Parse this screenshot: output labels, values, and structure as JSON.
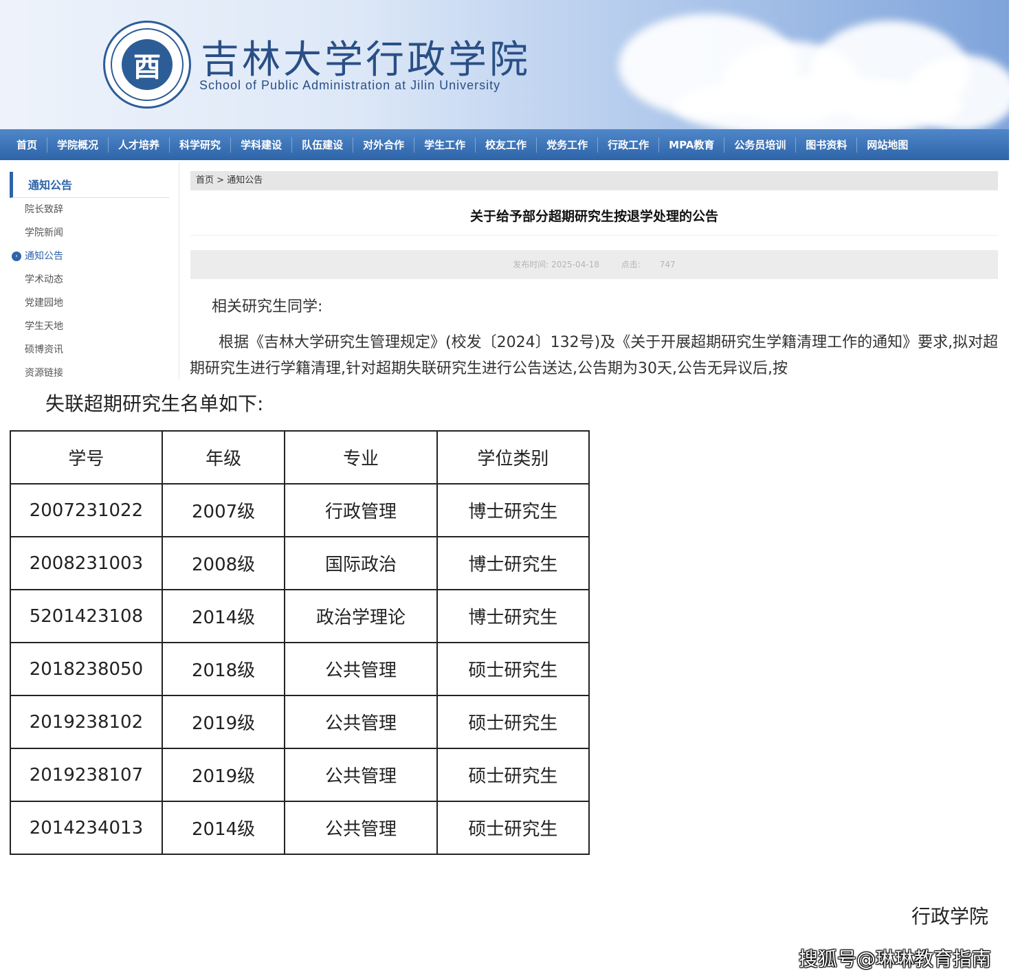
{
  "header": {
    "logo_glyph": "酉",
    "title_cn": "吉林大学行政学院",
    "title_en": "School of Public Administration at Jilin University"
  },
  "nav": {
    "items": [
      "首页",
      "学院概况",
      "人才培养",
      "科学研究",
      "学科建设",
      "队伍建设",
      "对外合作",
      "学生工作",
      "校友工作",
      "党务工作",
      "行政工作",
      "MPA教育",
      "公务员培训",
      "图书资料",
      "网站地图"
    ]
  },
  "sidebar": {
    "heading": "通知公告",
    "items": [
      {
        "label": "院长致辞",
        "active": false
      },
      {
        "label": "学院新闻",
        "active": false
      },
      {
        "label": "通知公告",
        "active": true
      },
      {
        "label": "学术动态",
        "active": false
      },
      {
        "label": "党建园地",
        "active": false
      },
      {
        "label": "学生天地",
        "active": false
      },
      {
        "label": "硕博资讯",
        "active": false
      },
      {
        "label": "资源链接",
        "active": false
      }
    ]
  },
  "breadcrumb": {
    "home": "首页",
    "separator": ">",
    "current": "通知公告"
  },
  "article": {
    "title": "关于给予部分超期研究生按退学处理的公告",
    "publish_label": "发布时间: 2025-04-18",
    "views_label": "点击:",
    "views_value": "747",
    "greeting": "相关研究生同学:",
    "paragraph": "根据《吉林大学研究生管理规定》(校发〔2024〕132号)及《关于开展超期研究生学籍清理工作的通知》要求,拟对超期研究生进行学籍清理,针对超期失联研究生进行公告送达,公告期为30天,公告无异议后,按"
  },
  "document": {
    "list_heading": "失联超期研究生名单如下:",
    "table": {
      "headers": [
        "学号",
        "年级",
        "专业",
        "学位类别"
      ],
      "rows": [
        [
          "2007231022",
          "2007级",
          "行政管理",
          "博士研究生"
        ],
        [
          "2008231003",
          "2008级",
          "国际政治",
          "博士研究生"
        ],
        [
          "5201423108",
          "2014级",
          "政治学理论",
          "博士研究生"
        ],
        [
          "2018238050",
          "2018级",
          "公共管理",
          "硕士研究生"
        ],
        [
          "2019238102",
          "2019级",
          "公共管理",
          "硕士研究生"
        ],
        [
          "2019238107",
          "2019级",
          "公共管理",
          "硕士研究生"
        ],
        [
          "2014234013",
          "2014级",
          "公共管理",
          "硕士研究生"
        ]
      ]
    },
    "signature": "行政学院",
    "watermark": "搜狐号@琳琳教育指南"
  }
}
